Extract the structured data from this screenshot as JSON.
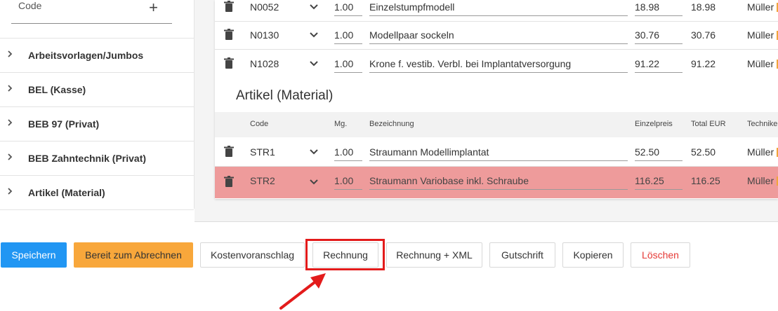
{
  "sidebar": {
    "code_label": "Code",
    "add_symbol": "+",
    "items": [
      {
        "label": "Arbeitsvorlagen/Jumbos"
      },
      {
        "label": "BEL (Kasse)"
      },
      {
        "label": "BEB 97 (Privat)"
      },
      {
        "label": "BEB Zahntechnik (Privat)"
      },
      {
        "label": "Artikel (Material)"
      }
    ]
  },
  "leistungen_rows": [
    {
      "code": "N0052",
      "qty": "1.00",
      "desc": "Einzelstumpfmodell",
      "price": "18.98",
      "total": "18.98",
      "tech": "Müller"
    },
    {
      "code": "N0130",
      "qty": "1.00",
      "desc": "Modellpaar sockeln",
      "price": "30.76",
      "total": "30.76",
      "tech": "Müller"
    },
    {
      "code": "N1028",
      "qty": "1.00",
      "desc": "Krone f. vestib. Verbl. bei Implantatversorgung",
      "price": "91.22",
      "total": "91.22",
      "tech": "Müller"
    }
  ],
  "material": {
    "title": "Artikel (Material)",
    "headers": {
      "code": "Code",
      "qty": "Mg.",
      "desc": "Bezeichnung",
      "price": "Einzelpreis",
      "total": "Total EUR",
      "tech": "Technike"
    },
    "rows": [
      {
        "code": "STR1",
        "qty": "1.00",
        "desc": "Straumann Modellimplantat",
        "price": "52.50",
        "total": "52.50",
        "tech": "Müller"
      },
      {
        "code": "STR2",
        "qty": "1.00",
        "desc": "Straumann Variobase inkl. Schraube",
        "price": "116.25",
        "total": "116.25",
        "tech": "Müller"
      }
    ],
    "highlight_color": "#ee9b9b"
  },
  "buttons": {
    "save": "Speichern",
    "ready": "Bereit zum Abrechnen",
    "estimate": "Kostenvoranschlag",
    "invoice": "Rechnung",
    "invoice_xml": "Rechnung + XML",
    "credit": "Gutschrift",
    "copy": "Kopieren",
    "delete": "Löschen"
  },
  "colors": {
    "primary": "#2196f3",
    "warning": "#f8a73b",
    "danger": "#e53935",
    "annotation": "#e31b1b"
  },
  "icons": {
    "delete": "trash-icon",
    "expand": "chevron-down-icon",
    "category": "chevron-right-icon"
  }
}
